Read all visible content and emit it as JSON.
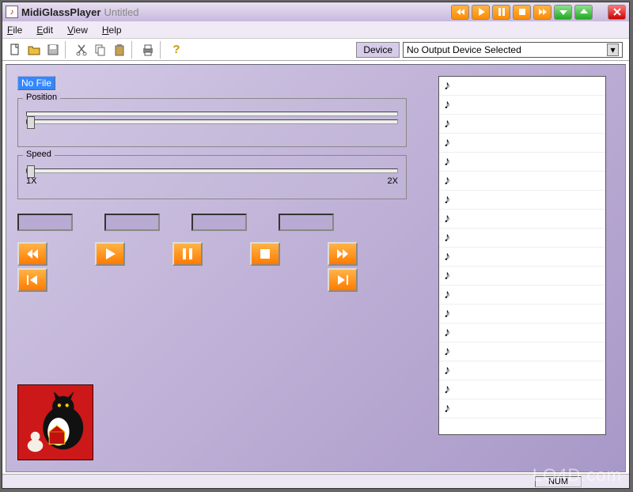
{
  "titlebar": {
    "appName": "MidiGlassPlayer",
    "docName": "Untitled"
  },
  "menu": {
    "file": "File",
    "edit": "Edit",
    "view": "View",
    "help": "Help"
  },
  "toolbar": {
    "new": "new",
    "open": "open",
    "save": "save",
    "cut": "cut",
    "copy": "copy",
    "paste": "paste",
    "print": "print",
    "help": "help"
  },
  "device": {
    "label": "Device",
    "selected": "No Output Device Selected"
  },
  "left": {
    "fileLabel": "No File",
    "positionLegend": "Position",
    "speedLegend": "Speed",
    "speedMin": "1X",
    "speedMax": "2X"
  },
  "playlist": {
    "rows": 18
  },
  "status": {
    "num": "NUM"
  },
  "watermark": "LO4D.com"
}
